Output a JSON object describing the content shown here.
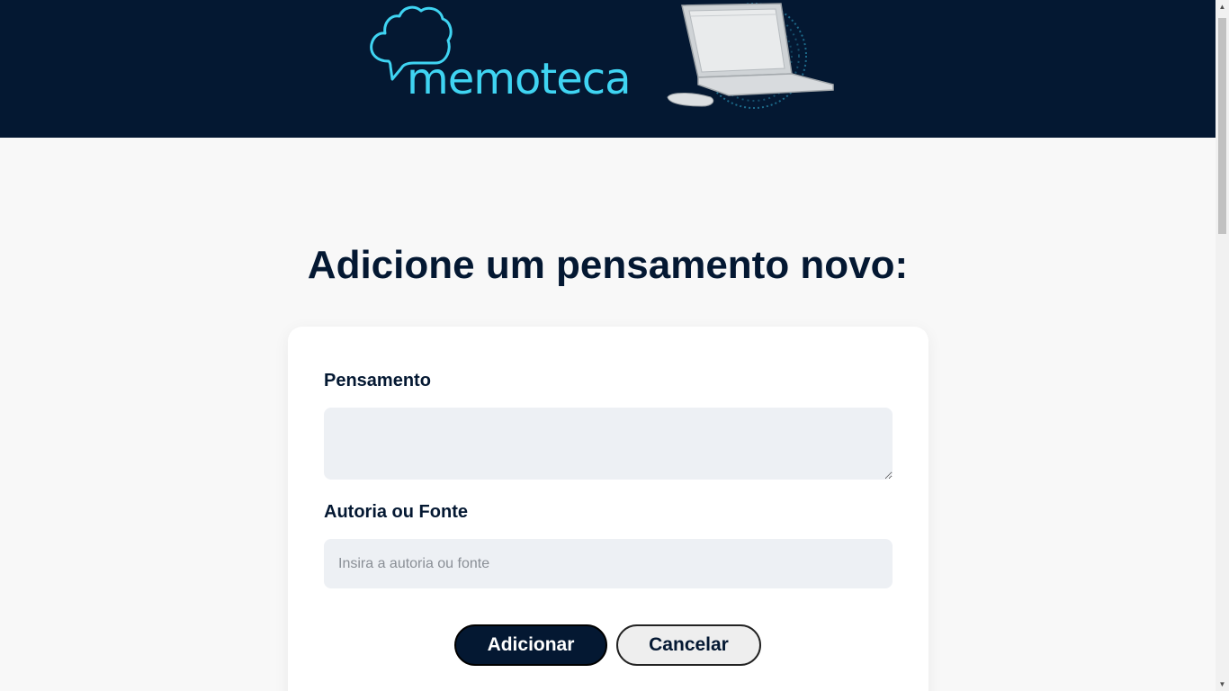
{
  "header": {
    "logo_text": "memoteca",
    "logo_icon": "thought-cloud-icon",
    "illustration": "laptop-illustration",
    "background_color": "#041832",
    "accent_color": "#3fd4f2"
  },
  "main": {
    "title": "Adicione um pensamento novo:"
  },
  "form": {
    "thought_label": "Pensamento",
    "thought_value": "",
    "author_label": "Autoria ou Fonte",
    "author_value": "",
    "author_placeholder": "Insira a autoria ou fonte",
    "add_button_label": "Adicionar",
    "cancel_button_label": "Cancelar"
  },
  "scrollbar": {
    "up_icon": "arrow-up-icon",
    "down_icon": "arrow-down-icon"
  }
}
